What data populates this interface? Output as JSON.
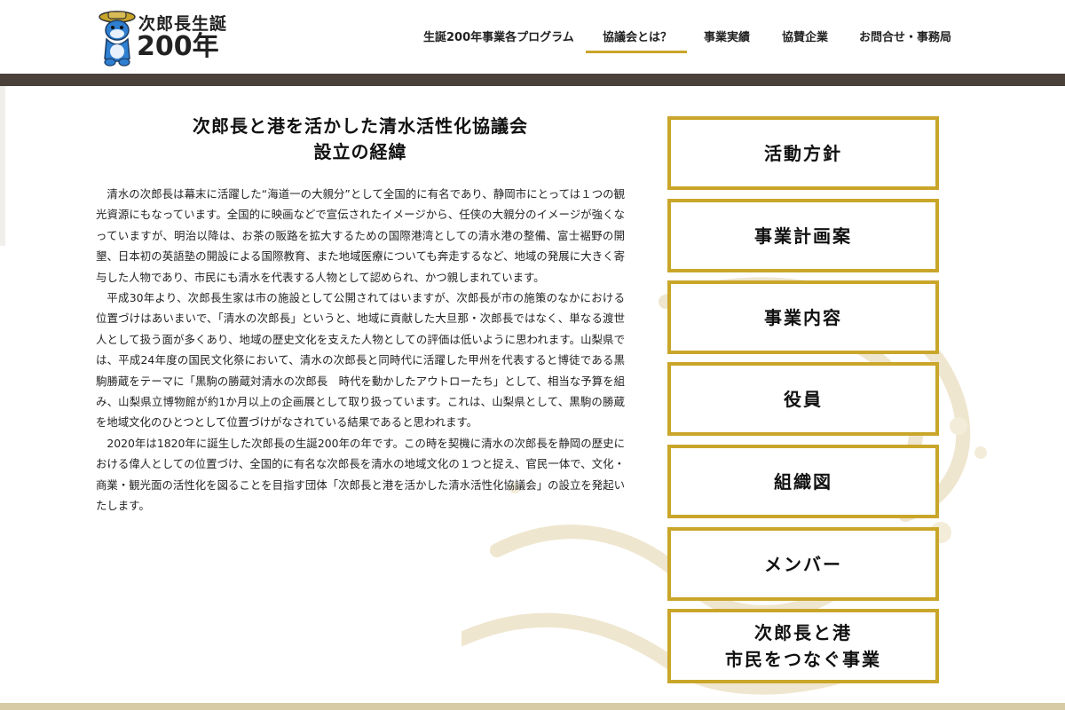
{
  "logo": {
    "line1": "次郎長生誕",
    "line2": "200年"
  },
  "nav": {
    "items": [
      {
        "label": "生誕200年事業各プログラム"
      },
      {
        "label": "協議会とは？"
      },
      {
        "label": "事業実績"
      },
      {
        "label": "協賛企業"
      },
      {
        "label": "お問合せ・事務局"
      }
    ],
    "active_index": 1
  },
  "article": {
    "title_line1": "次郎長と港を活かした清水活性化協議会",
    "title_line2": "設立の経緯",
    "paragraphs": [
      "清水の次郎長は幕末に活躍した“海道一の大親分”として全国的に有名であり、静岡市にとっては１つの観光資源にもなっています。全国的に映画などで宣伝されたイメージから、任侠の大親分のイメージが強くなっていますが、明治以降は、お茶の販路を拡大するための国際港湾としての清水港の整備、富士裾野の開墾、日本初の英語塾の開設による国際教育、また地域医療についても奔走するなど、地域の発展に大きく寄与した人物であり、市民にも清水を代表する人物として認められ、かつ親しまれています。",
      "平成30年より、次郎長生家は市の施設として公開されてはいますが、次郎長が市の施策のなかにおける位置づけはあいまいで、「清水の次郎長」というと、地域に貢献した大旦那・次郎長ではなく、単なる渡世人として扱う面が多くあり、地域の歴史文化を支えた人物としての評価は低いように思われます。山梨県では、平成24年度の国民文化祭において、清水の次郎長と同時代に活躍した甲州を代表すると博徒である黒駒勝蔵をテーマに「黒駒の勝蔵対清水の次郎長　時代を動かしたアウトローたち」として、相当な予算を組み、山梨県立博物館が約1か月以上の企画展として取り扱っています。これは、山梨県として、黒駒の勝蔵を地域文化のひとつとして位置づけがなされている結果であると思われます。",
      "2020年は1820年に誕生した次郎長の生誕200年の年です。この時を契機に清水の次郎長を静岡の歴史における偉人としての位置づけ、全国的に有名な次郎長を清水の地域文化の１つと捉え、官民一体で、文化・商業・観光面の活性化を図ることを目指す団体「次郎長と港を活かした清水活性化協議会」の設立を発起いたします。"
    ]
  },
  "sidebar": {
    "buttons": [
      {
        "label": "活動方針"
      },
      {
        "label": "事業計画案"
      },
      {
        "label": "事業内容"
      },
      {
        "label": "役員"
      },
      {
        "label": "組織図"
      },
      {
        "label": "メンバー"
      },
      {
        "label_line1": "次郎長と港",
        "label_line2": "市民をつなぐ事業"
      }
    ]
  },
  "colors": {
    "accent_gold": "#c9a62a",
    "header_bar": "#4a413b"
  }
}
